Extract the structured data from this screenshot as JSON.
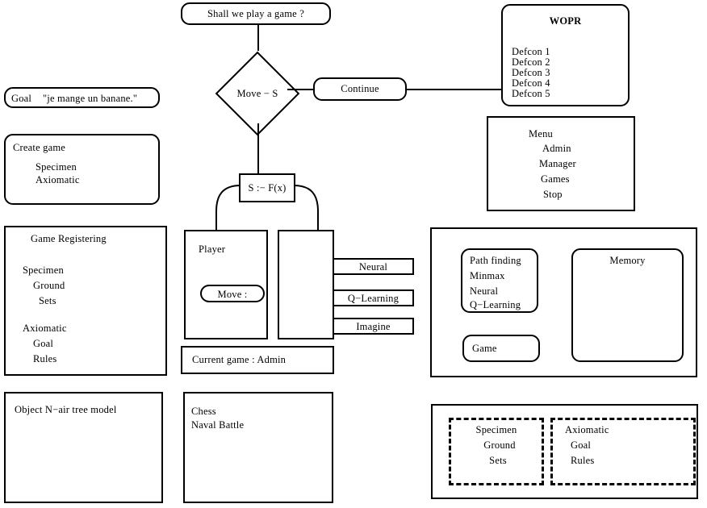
{
  "diagram": {
    "title_node": {
      "label": "Shall we play a game ?"
    },
    "decision": {
      "label": "Move − S"
    },
    "continue_node": {
      "label": "Continue"
    },
    "assign_node": {
      "label": "S :− F(x)"
    },
    "goal_node": {
      "label_key": "Goal",
      "label_value": "\"je mange un banane.\""
    },
    "create_game": {
      "title": "Create game",
      "items": [
        "Specimen",
        "Axiomatic"
      ]
    },
    "game_registering": {
      "title": "Game Registering",
      "group_a_title": "Specimen",
      "group_a_items": [
        "Ground",
        "Sets"
      ],
      "group_b_title": "Axiomatic",
      "group_b_items": [
        "Goal",
        "Rules"
      ]
    },
    "object_model": {
      "label": "Object N−air tree model"
    },
    "player_box": {
      "title": "Player",
      "move_button": "Move :"
    },
    "current_game": {
      "label": "Current game : Admin"
    },
    "games_list": {
      "items": [
        "Chess",
        "Naval Battle"
      ]
    },
    "method_boxes": [
      {
        "label": "Neural"
      },
      {
        "label": "Q−Learning"
      },
      {
        "label": "Imagine"
      }
    ],
    "wopr": {
      "title": "WOPR",
      "items": [
        "Defcon 1",
        "Defcon 2",
        "Defcon 3",
        "Defcon 4",
        "Defcon 5"
      ]
    },
    "menu": {
      "title": "Menu",
      "items": [
        "Admin",
        "Manager",
        "Games",
        "Stop"
      ]
    },
    "engine_panel": {
      "algorithms": [
        "Path finding",
        "Minmax",
        "Neural",
        "Q−Learning"
      ],
      "game_label": "Game",
      "memory_label": "Memory"
    },
    "knowledge_panel": {
      "left": {
        "title": "Specimen",
        "items": [
          "Ground",
          "Sets"
        ]
      },
      "right": {
        "title": "Axiomatic",
        "items": [
          "Goal",
          "Rules"
        ]
      }
    },
    "colors": {
      "stroke": "#000000",
      "background": "#ffffff"
    }
  }
}
